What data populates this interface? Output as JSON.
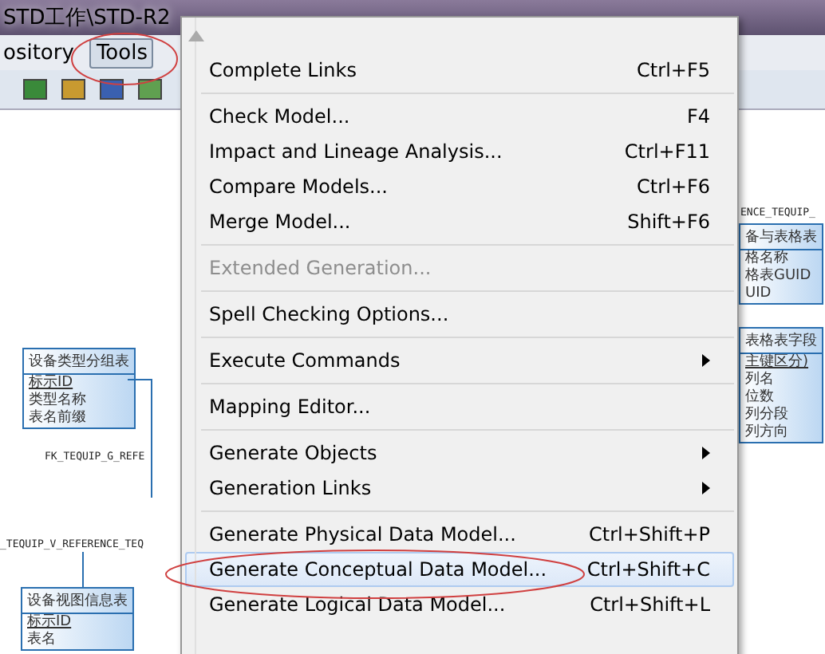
{
  "window": {
    "title": "STD工作\\STD-R2"
  },
  "menubar": [
    {
      "label": "ository",
      "selected": false
    },
    {
      "label": "Tools",
      "selected": true
    }
  ],
  "menu": {
    "items": [
      {
        "kind": "item",
        "label": "Complete Links",
        "shortcut": "Ctrl+F5",
        "disabled": false,
        "selected": false
      },
      {
        "kind": "separator"
      },
      {
        "kind": "item",
        "label": "Check Model...",
        "shortcut": "F4",
        "disabled": false,
        "selected": false
      },
      {
        "kind": "item",
        "label": "Impact and Lineage Analysis...",
        "shortcut": "Ctrl+F11",
        "disabled": false,
        "selected": false
      },
      {
        "kind": "item",
        "label": "Compare Models...",
        "shortcut": "Ctrl+F6",
        "disabled": false,
        "selected": false
      },
      {
        "kind": "item",
        "label": "Merge Model...",
        "shortcut": "Shift+F6",
        "disabled": false,
        "selected": false
      },
      {
        "kind": "separator"
      },
      {
        "kind": "item",
        "label": "Extended Generation...",
        "disabled": true,
        "selected": false
      },
      {
        "kind": "separator"
      },
      {
        "kind": "item",
        "label": "Spell Checking Options...",
        "disabled": false,
        "selected": false
      },
      {
        "kind": "separator"
      },
      {
        "kind": "submenu",
        "label": "Execute Commands",
        "disabled": false,
        "selected": false
      },
      {
        "kind": "separator"
      },
      {
        "kind": "item",
        "label": "Mapping Editor...",
        "disabled": false,
        "selected": false
      },
      {
        "kind": "separator"
      },
      {
        "kind": "submenu",
        "label": "Generate Objects",
        "disabled": false,
        "selected": false
      },
      {
        "kind": "submenu",
        "label": "Generation Links",
        "disabled": false,
        "selected": false
      },
      {
        "kind": "separator"
      },
      {
        "kind": "item",
        "label": "Generate Physical Data Model...",
        "shortcut": "Ctrl+Shift+P",
        "disabled": false,
        "selected": false
      },
      {
        "kind": "item",
        "label": "Generate Conceptual Data Model...",
        "shortcut": "Ctrl+Shift+C",
        "disabled": false,
        "selected": true
      },
      {
        "kind": "item",
        "label": "Generate Logical Data Model...",
        "shortcut": "Ctrl+Shift+L",
        "disabled": false,
        "selected": false
      }
    ]
  },
  "diagram": {
    "tables": [
      {
        "title": "设备类型分组表",
        "columns": [
          {
            "name": "标示ID",
            "key": true
          },
          {
            "name": "类型名称",
            "key": false
          },
          {
            "name": "表名前缀",
            "key": false
          }
        ]
      },
      {
        "title": "设备视图信息表",
        "columns": [
          {
            "name": "标示ID",
            "key": true
          },
          {
            "name": "表名",
            "key": false
          }
        ]
      },
      {
        "title": "备与表格表",
        "columns": [
          {
            "name": "格名称",
            "key": false
          },
          {
            "name": "格表GUID",
            "key": false
          },
          {
            "name": "UID",
            "key": false
          }
        ]
      },
      {
        "title": "表格表字段",
        "columns": [
          {
            "name": "主键区分)",
            "key": true
          },
          {
            "name": "列名",
            "key": false
          },
          {
            "name": "位数",
            "key": false
          },
          {
            "name": "列分段",
            "key": false
          },
          {
            "name": "列方向",
            "key": false
          }
        ]
      }
    ],
    "references": [
      "FK_TEQUIP_G_REFE",
      "_TEQUIP_V_REFERENCE_TEQ",
      "ENCE_TEQUIP_"
    ]
  }
}
